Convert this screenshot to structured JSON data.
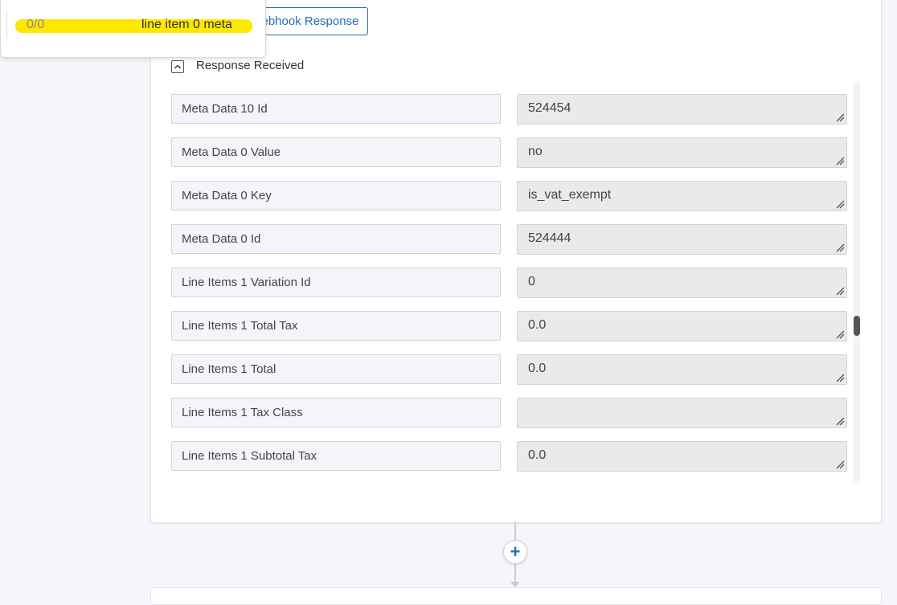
{
  "webhook": {
    "button_label": "Webhook Response"
  },
  "response": {
    "section_title": "Response Received"
  },
  "fields": [
    {
      "key": "Meta Data 10 Id",
      "value": "524454"
    },
    {
      "key": "Meta Data 0 Value",
      "value": "no"
    },
    {
      "key": "Meta Data 0 Key",
      "value": "is_vat_exempt"
    },
    {
      "key": "Meta Data 0 Id",
      "value": "524444"
    },
    {
      "key": "Line Items 1 Variation Id",
      "value": "0"
    },
    {
      "key": "Line Items 1 Total Tax",
      "value": "0.0"
    },
    {
      "key": "Line Items 1 Total",
      "value": "0.0"
    },
    {
      "key": "Line Items 1 Tax Class",
      "value": ""
    },
    {
      "key": "Line Items 1 Subtotal Tax",
      "value": "0.0"
    }
  ],
  "find_popup": {
    "match_count": "0/0",
    "query": "line item 0 meta"
  },
  "add_step": {
    "symbol": "+"
  },
  "colors": {
    "accent": "#1f6fb8",
    "highlight": "#ffe800"
  },
  "icons": {
    "collapse": "chevron-up-icon",
    "resize": "resize-grip-icon",
    "add": "plus-icon"
  }
}
